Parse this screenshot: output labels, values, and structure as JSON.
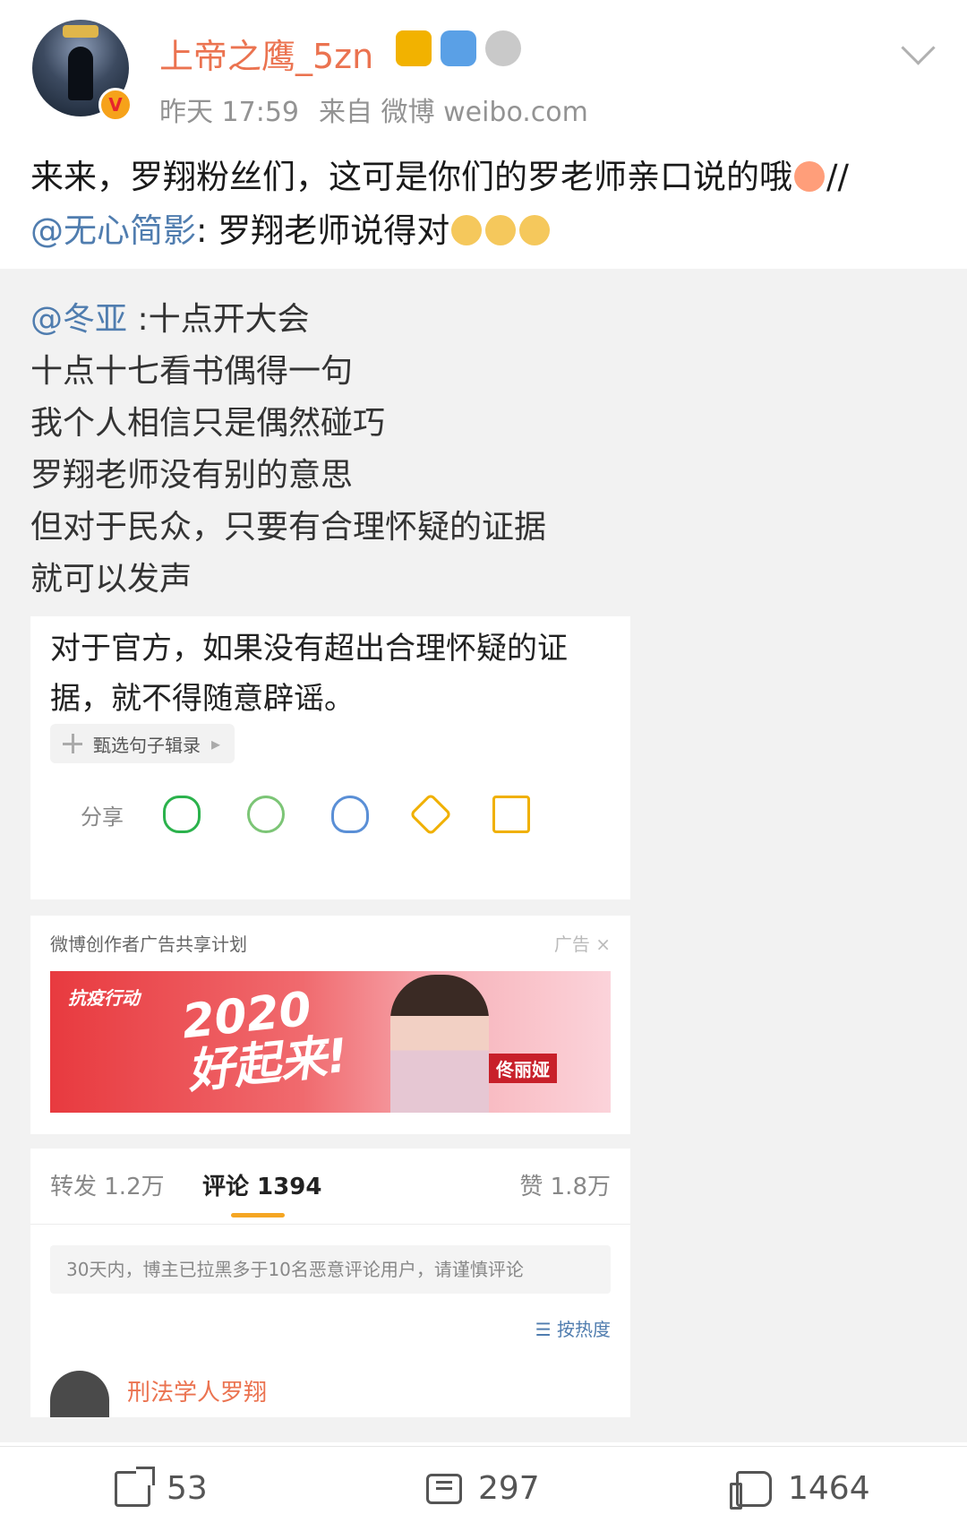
{
  "header": {
    "username": "上帝之鹰_5zn",
    "verified_mark": "V",
    "badges": [
      "crown-badge",
      "backpack-badge",
      "medal-badge"
    ],
    "time": "昨天 17:59",
    "source": "来自 微博 weibo.com"
  },
  "post": {
    "text_1": "来来，罗翔粉丝们，这可是你们的罗老师亲口说的哦",
    "text_2": "//",
    "mention": "@无心简影",
    "text_3": ": 罗翔老师说得对"
  },
  "repost": {
    "mention": "@冬亚",
    "line_1": " :十点开大会",
    "lines": [
      "十点十七看书偶得一句",
      "我个人相信只是偶然碰巧",
      "罗翔老师没有别的意思",
      "但对于民众，只要有合理怀疑的证据",
      "就可以发声"
    ]
  },
  "quote_card": {
    "text": "对于官方，如果没有超出合理怀疑的证据，就不得随意辟谣。",
    "source_chip": "甄选句子辑录",
    "share_label": "分享"
  },
  "ad": {
    "label": "微博创作者广告共享计划",
    "tag": "广告",
    "close": "×",
    "small": "抗疫行动",
    "big_1": "2020",
    "big_2": "好起来!",
    "name": "佟丽娅"
  },
  "stats": {
    "forward": "转发 1.2万",
    "comment": "评论 1394",
    "like": "赞 1.8万",
    "notice": "30天内，博主已拉黑多于10名恶意评论用户，请谨慎评论",
    "sort": "按热度",
    "peek_name": "刑法学人罗翔"
  },
  "actions": {
    "forward": "53",
    "comment": "297",
    "like": "1464"
  },
  "colors": {
    "username": "#eb7350",
    "mention": "#507daf",
    "accent_underline": "#f5a623"
  }
}
